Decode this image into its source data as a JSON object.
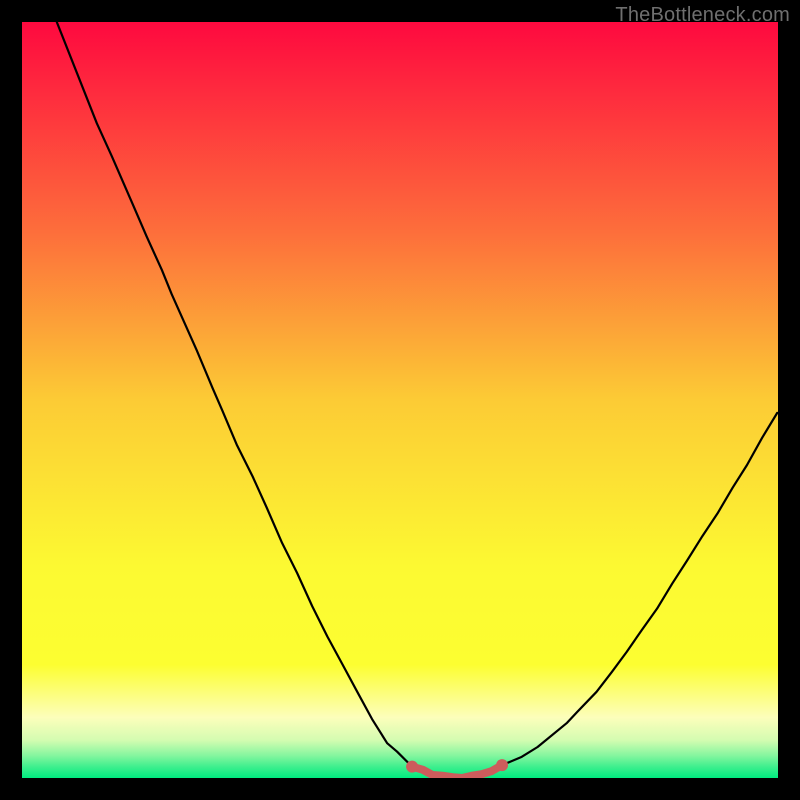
{
  "watermark": "TheBottleneck.com",
  "chart_data": {
    "type": "line",
    "title": "",
    "xlabel": "",
    "ylabel": "",
    "xlim": [
      0,
      100
    ],
    "ylim": [
      0,
      100
    ],
    "series": [
      {
        "name": "curve-left",
        "x": [
          4.6,
          9.9,
          11.9,
          14.6,
          16.5,
          18.5,
          19.8,
          23.1,
          25.2,
          26.5,
          28.4,
          30.5,
          32.4,
          34.4,
          36.4,
          38.4,
          40.4,
          42.3,
          44.4,
          46.3,
          48.3,
          49.6,
          51.6
        ],
        "y": [
          100,
          86.6,
          82.2,
          76.0,
          71.6,
          67.2,
          64.0,
          56.6,
          51.6,
          48.6,
          44.1,
          39.9,
          35.7,
          31.1,
          27.1,
          22.7,
          18.7,
          15.2,
          11.3,
          7.8,
          4.6,
          3.5,
          1.5
        ]
      },
      {
        "name": "marker-segment",
        "x": [
          51.6,
          53.0,
          54.3,
          55.6,
          57.0,
          58.2,
          59.5,
          60.8,
          62.1,
          63.5
        ],
        "y": [
          1.5,
          1.1,
          0.4,
          0.3,
          0.1,
          0.0,
          0.3,
          0.5,
          0.9,
          1.7
        ]
      },
      {
        "name": "curve-right",
        "x": [
          63.5,
          66.1,
          68.2,
          72.1,
          73.4,
          76.0,
          78.0,
          80.0,
          82.0,
          84.0,
          86.0,
          88.0,
          90.0,
          92.0,
          94.0,
          95.9,
          97.9,
          99.9
        ],
        "y": [
          1.7,
          2.8,
          4.1,
          7.3,
          8.7,
          11.4,
          14.0,
          16.7,
          19.6,
          22.4,
          25.7,
          28.8,
          32.0,
          35.0,
          38.4,
          41.4,
          45.0,
          48.3
        ]
      }
    ],
    "marker_style": {
      "color": "#CD5C5C",
      "width": 8,
      "type": "segment_with_end_dots"
    },
    "background_gradient": [
      {
        "pos": 0.0,
        "color": "#fe093f"
      },
      {
        "pos": 0.28,
        "color": "#fd6f3b"
      },
      {
        "pos": 0.5,
        "color": "#fccb35"
      },
      {
        "pos": 0.72,
        "color": "#fcf932"
      },
      {
        "pos": 0.85,
        "color": "#fcfe31"
      },
      {
        "pos": 0.92,
        "color": "#fcfebb"
      },
      {
        "pos": 0.95,
        "color": "#d4fcb1"
      },
      {
        "pos": 0.97,
        "color": "#86f69f"
      },
      {
        "pos": 0.985,
        "color": "#3fef8e"
      },
      {
        "pos": 1.0,
        "color": "#00eb7f"
      }
    ],
    "grid": false,
    "legend": false
  }
}
